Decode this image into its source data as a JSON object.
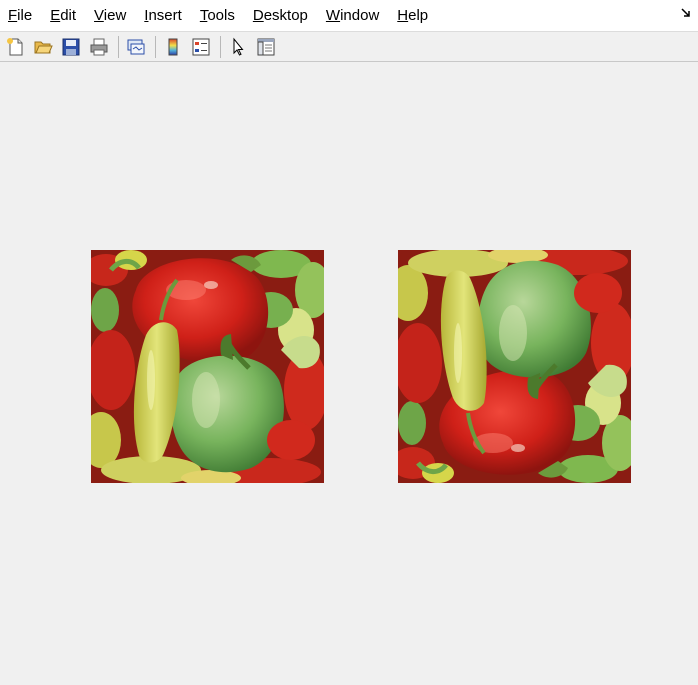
{
  "menubar": {
    "items": [
      {
        "accel": "F",
        "rest": "ile"
      },
      {
        "accel": "E",
        "rest": "dit"
      },
      {
        "accel": "V",
        "rest": "iew"
      },
      {
        "accel": "I",
        "rest": "nsert"
      },
      {
        "accel": "T",
        "rest": "ools"
      },
      {
        "accel": "D",
        "rest": "esktop"
      },
      {
        "accel": "W",
        "rest": "indow"
      },
      {
        "accel": "H",
        "rest": "elp"
      }
    ]
  },
  "toolbar": {
    "buttons": [
      "new-figure-icon",
      "open-file-icon",
      "save-figure-icon",
      "print-figure-icon",
      "link-plot-icon",
      "insert-colorbar-icon",
      "insert-legend-icon",
      "edit-plot-icon",
      "property-inspector-icon"
    ]
  },
  "figure": {
    "images": [
      "peppers-original",
      "peppers-flipped"
    ]
  },
  "colors": {
    "red": "#c8201a",
    "green": "#6aa84f",
    "yellow_green": "#c9cc4a",
    "background": "#f0f0f0"
  }
}
